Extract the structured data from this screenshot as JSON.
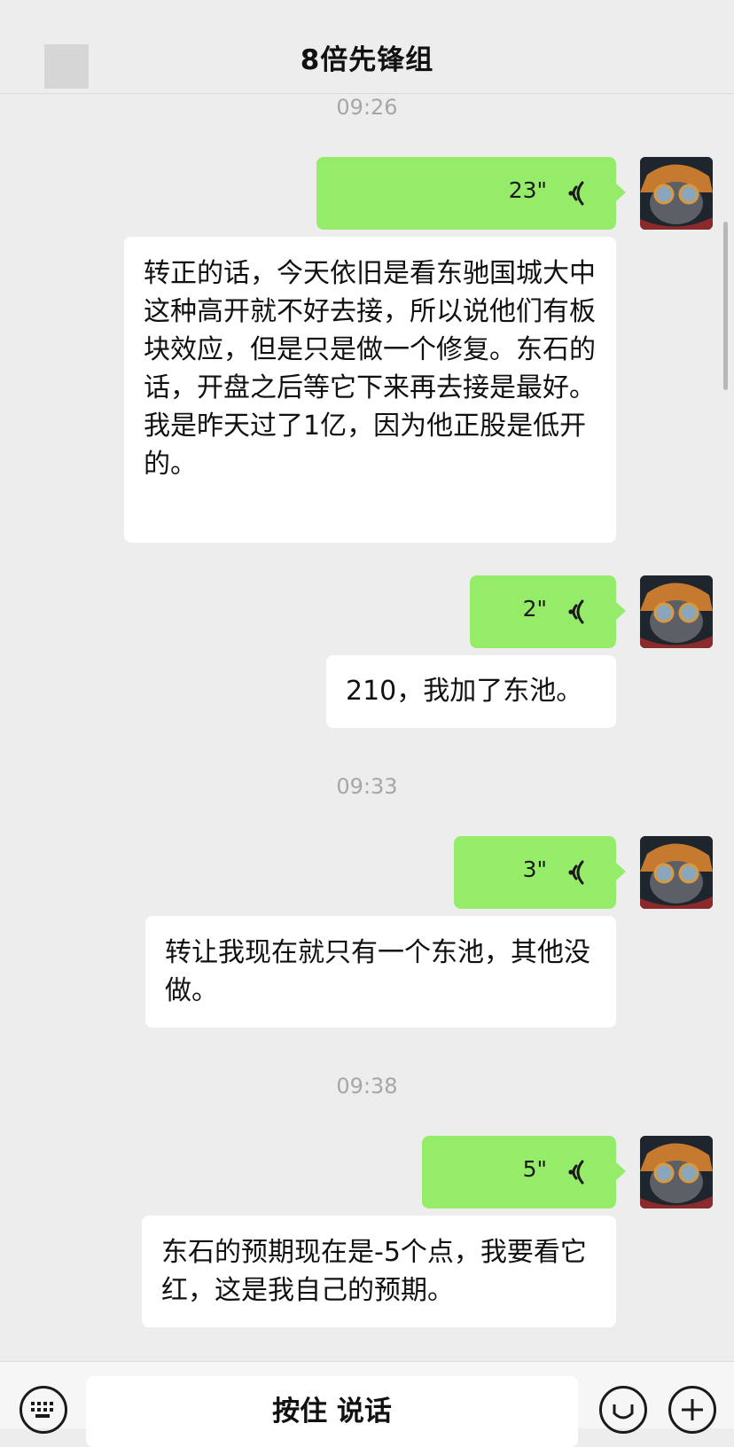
{
  "header": {
    "title": "8倍先锋组"
  },
  "messages": {
    "ts1": "09:26",
    "v1": "23\"",
    "t1": "转正的话，今天依旧是看东驰国城大中这种高开就不好去接，所以说他们有板块效应，但是只是做一个修复。东石的话，开盘之后等它下来再去接是最好。我是昨天过了1亿，因为他正股是低开的。",
    "v2": "2\"",
    "t2": "210，我加了东池。",
    "ts2": "09:33",
    "v3": "3\"",
    "t3": "转让我现在就只有一个东池，其他没做。",
    "ts3": "09:38",
    "v4": "5\"",
    "t4": "东石的预期现在是-5个点，我要看它红，这是我自己的预期。"
  },
  "input_bar": {
    "hold_to_talk": "按住 说话"
  },
  "colors": {
    "sent_bubble": "#95ec69",
    "background": "#ededed",
    "timestamp": "#a6a6a6"
  }
}
